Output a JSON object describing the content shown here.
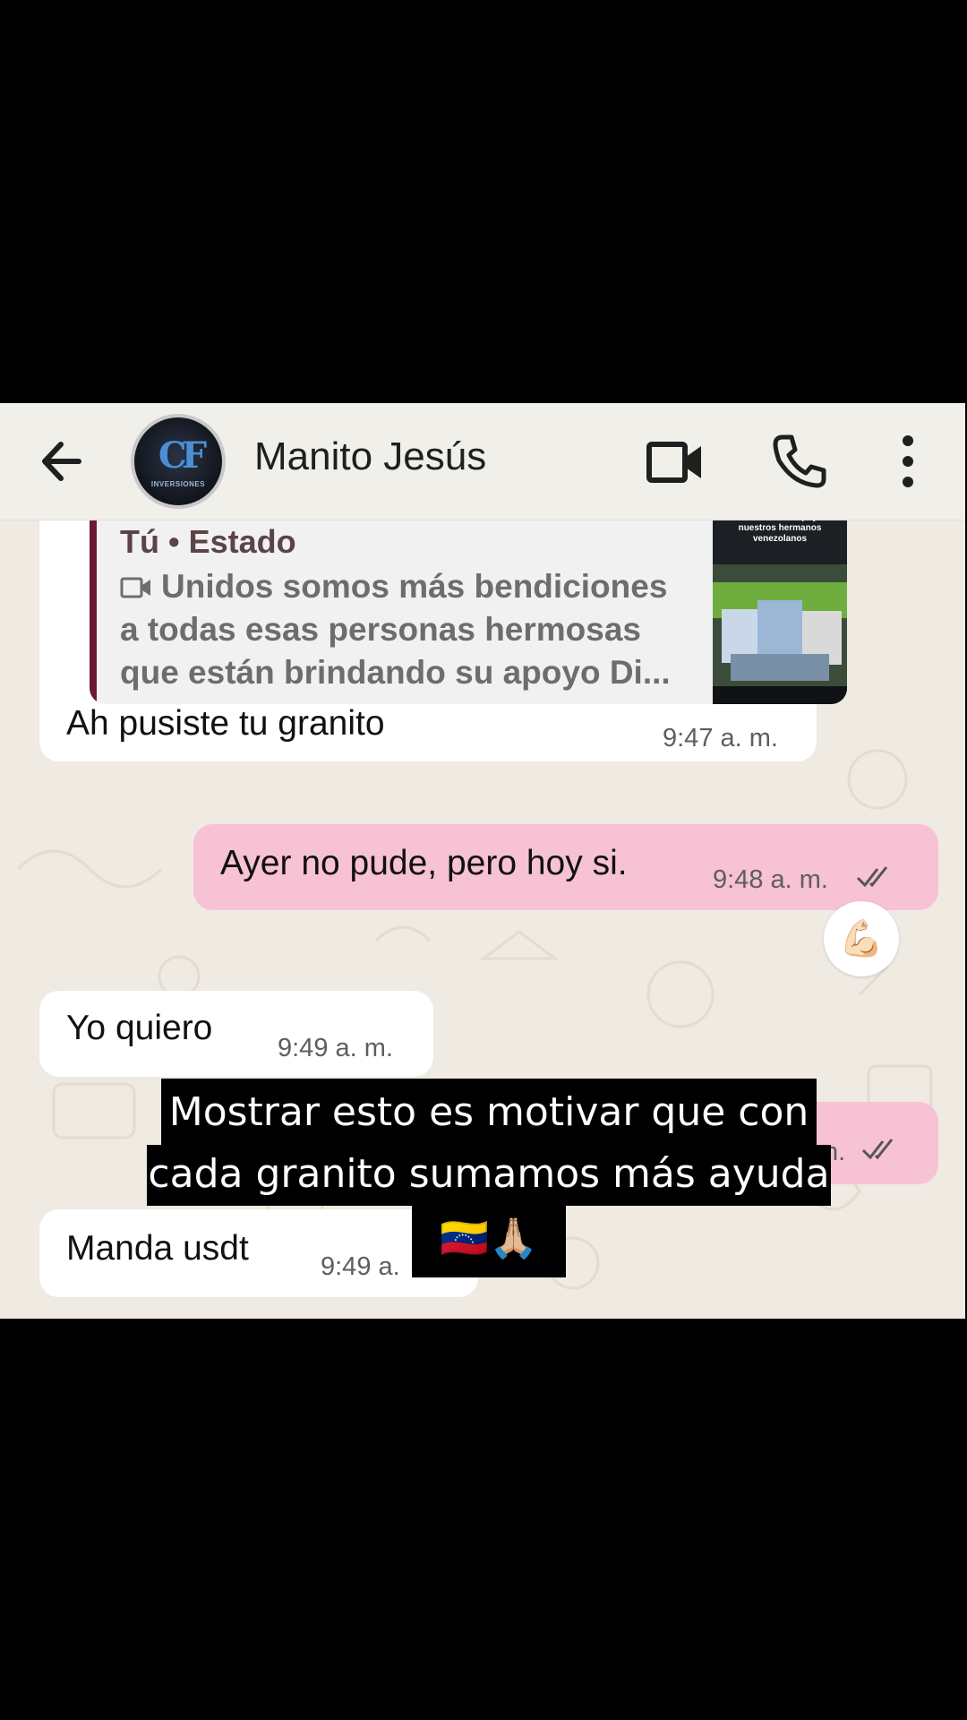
{
  "header": {
    "contact_name": "Manito Jesús",
    "avatar_text": "INVERSIONES"
  },
  "messages": {
    "quoted": {
      "author": "Tú • Estado",
      "lines": [
        "Unidos somos más bendiciones",
        "a todas esas personas hermosas",
        "que están brindando su apoyo Di..."
      ],
      "thumbnail_caption": "TUMEREMO en apoyo a nuestros hermanos venezolanos"
    },
    "m1": {
      "text": "Ah pusiste tu granito",
      "time": "9:47 a. m."
    },
    "m2": {
      "text": "Ayer no pude, pero hoy si.",
      "time": "9:48 a. m.",
      "reaction": "💪🏻"
    },
    "m3": {
      "text": "Yo quiero",
      "time": "9:49 a. m."
    },
    "m4": {
      "time_partial": "n."
    },
    "m5": {
      "text": "Manda usdt",
      "time_partial": "9:49 a."
    }
  },
  "caption": {
    "line1": "Mostrar esto es motivar que con",
    "line2": "cada granito sumamos más ayuda",
    "line3": "🇻🇪🙏🏼"
  },
  "colors": {
    "outgoing_bubble": "#f7c2d3",
    "incoming_bubble": "#ffffff",
    "chat_background": "#efeae2",
    "quote_bar": "#6b1a33"
  },
  "icons": [
    "back-arrow-icon",
    "video-call-icon",
    "phone-icon",
    "more-options-icon",
    "double-check-icon",
    "video-camera-icon"
  ]
}
